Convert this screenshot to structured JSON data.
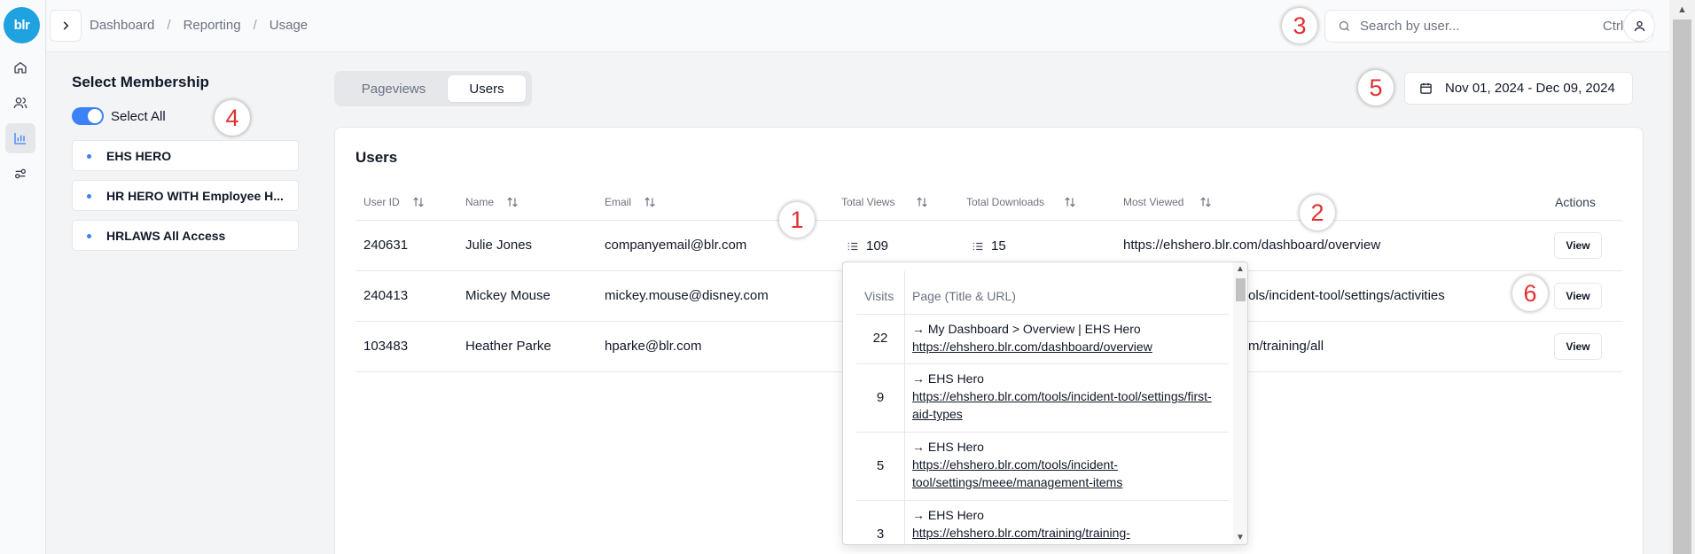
{
  "logo": "blr",
  "breadcrumb": [
    "Dashboard",
    "Reporting",
    "Usage"
  ],
  "search": {
    "placeholder": "Search by user...",
    "shortcut": "Ctrl+K"
  },
  "membership": {
    "title": "Select Membership",
    "select_all": "Select All",
    "select_all_on": true,
    "items": [
      "EHS HERO",
      "HR HERO WITH Employee H...",
      "HRLAWS All Access"
    ]
  },
  "tabs": [
    "Pageviews",
    "Users"
  ],
  "active_tab": "Users",
  "date_range": "Nov 01, 2024 - Dec 09, 2024",
  "users": {
    "title": "Users",
    "columns": [
      "User ID",
      "Name",
      "Email",
      "Total Views",
      "Total Downloads",
      "Most Viewed",
      "Actions"
    ],
    "rows": [
      {
        "user_id": "240631",
        "name": "Julie Jones",
        "email": "companyemail@blr.com",
        "total_views": "109",
        "total_downloads": "15",
        "most_viewed": "https://ehshero.blr.com/dashboard/overview",
        "action": "View"
      },
      {
        "user_id": "240413",
        "name": "Mickey Mouse",
        "email": "mickey.mouse@disney.com",
        "most_viewed": "ols/incident-tool/settings/activities",
        "action": "View"
      },
      {
        "user_id": "103483",
        "name": "Heather Parke",
        "email": "hparke@blr.com",
        "most_viewed": "m/training/all",
        "action": "View"
      }
    ]
  },
  "popover": {
    "headers": [
      "Visits",
      "Page (Title & URL)"
    ],
    "rows": [
      {
        "visits": "22",
        "title": "→ My Dashboard > Overview | EHS Hero",
        "url": "https://ehshero.blr.com/dashboard/overview"
      },
      {
        "visits": "9",
        "title": "→ EHS Hero",
        "url": "https://ehshero.blr.com/tools/incident-tool/settings/first-aid-types"
      },
      {
        "visits": "5",
        "title": "→ EHS Hero",
        "url": "https://ehshero.blr.com/tools/incident-tool/settings/meee/management-items"
      },
      {
        "visits": "3",
        "title": "→ EHS Hero",
        "url": "https://ehshero.blr.com/training/training-"
      }
    ]
  },
  "markers": [
    "1",
    "2",
    "3",
    "4",
    "5",
    "6"
  ],
  "colors": {
    "accent": "#3b82f6",
    "logo": "#1fa2e0",
    "marker": "#e03131"
  },
  "icons": [
    "home-icon",
    "users-icon",
    "bar-chart-icon",
    "sliders-icon",
    "chevron-right-icon",
    "search-icon",
    "user-icon",
    "calendar-icon",
    "sort-icon",
    "list-icon"
  ]
}
